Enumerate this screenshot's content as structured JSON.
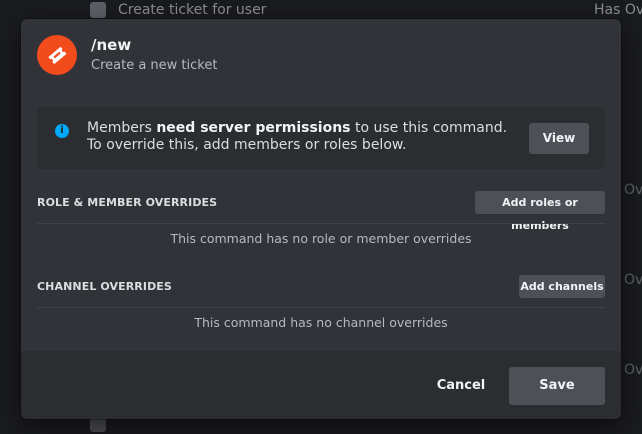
{
  "background": {
    "row_label": "Create ticket for user",
    "row_right": "Has Ove",
    "side_fragments": [
      "Ov",
      "Ov",
      "Ov"
    ]
  },
  "command": {
    "name": "/new",
    "description": "Create a new ticket",
    "icon": "ticket-icon",
    "icon_color": "#f24b1c"
  },
  "notice": {
    "icon": "info-icon",
    "text_prefix": "Members ",
    "text_bold": "need server permissions",
    "text_suffix": " to use this command. To override this, add members or roles below.",
    "button_label": "View"
  },
  "role_section": {
    "heading": "ROLE & MEMBER OVERRIDES",
    "button_label": "Add roles or members",
    "empty_text": "This command has no role or member overrides"
  },
  "channel_section": {
    "heading": "CHANNEL OVERRIDES",
    "button_label": "Add channels",
    "empty_text": "This command has no channel overrides"
  },
  "footer": {
    "cancel_label": "Cancel",
    "save_label": "Save"
  },
  "colors": {
    "modal_bg": "#313338",
    "secondary_bg": "#2b2d31",
    "button_bg": "#4e5058",
    "info_blue": "#00a8fc"
  }
}
